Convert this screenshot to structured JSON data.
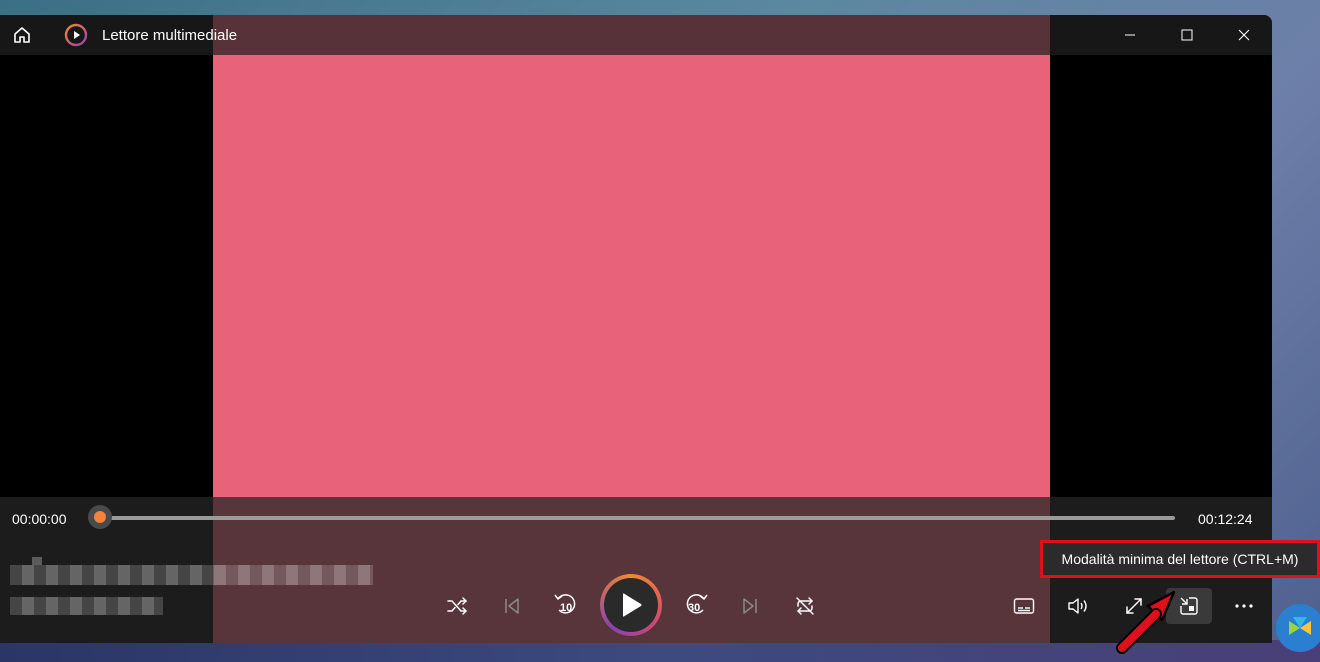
{
  "window": {
    "title": "Lettore multimediale"
  },
  "player": {
    "time_elapsed": "00:00:00",
    "time_total": "00:12:24",
    "progress": 0,
    "video_color": "#e8637a"
  },
  "tooltip": {
    "text": "Modalità minima del lettore (CTRL+M)"
  },
  "icons": {
    "home": "home-icon",
    "app": "media-player-icon",
    "minimize": "minimize-icon",
    "maximize": "maximize-icon",
    "close": "close-icon",
    "shuffle": "shuffle-icon",
    "previous": "previous-icon",
    "skip_back": "skip-back-10-icon",
    "play": "play-icon",
    "skip_forward": "skip-forward-30-icon",
    "next": "next-icon",
    "repeat": "repeat-icon",
    "subtitles": "subtitles-icon",
    "volume": "volume-icon",
    "fullscreen": "fullscreen-icon",
    "miniplayer": "miniplayer-icon",
    "more": "more-icon"
  },
  "colors": {
    "accent_orange": "#f5813a",
    "annotation_red": "#e0101a"
  }
}
